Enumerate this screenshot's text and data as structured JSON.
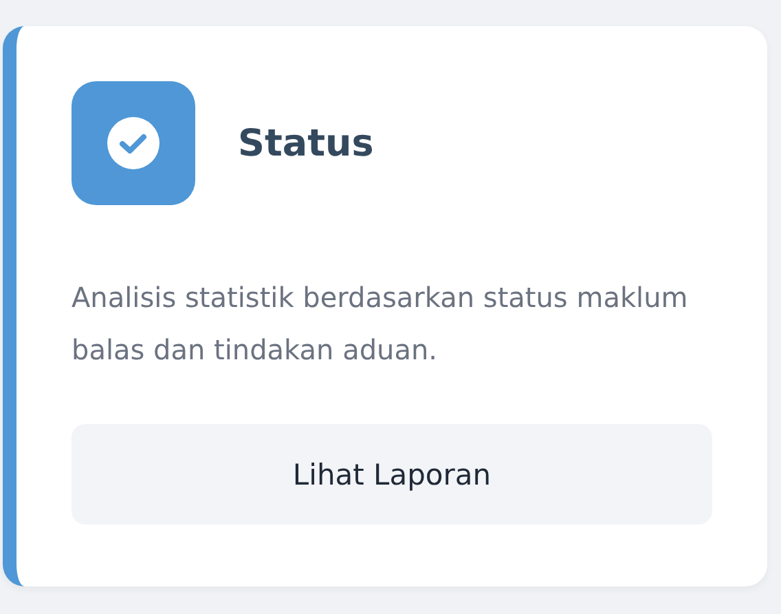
{
  "card": {
    "title": "Status",
    "description": "Analisis statistik berdasarkan status maklum balas dan tindakan aduan.",
    "button": "Lihat Laporan"
  }
}
